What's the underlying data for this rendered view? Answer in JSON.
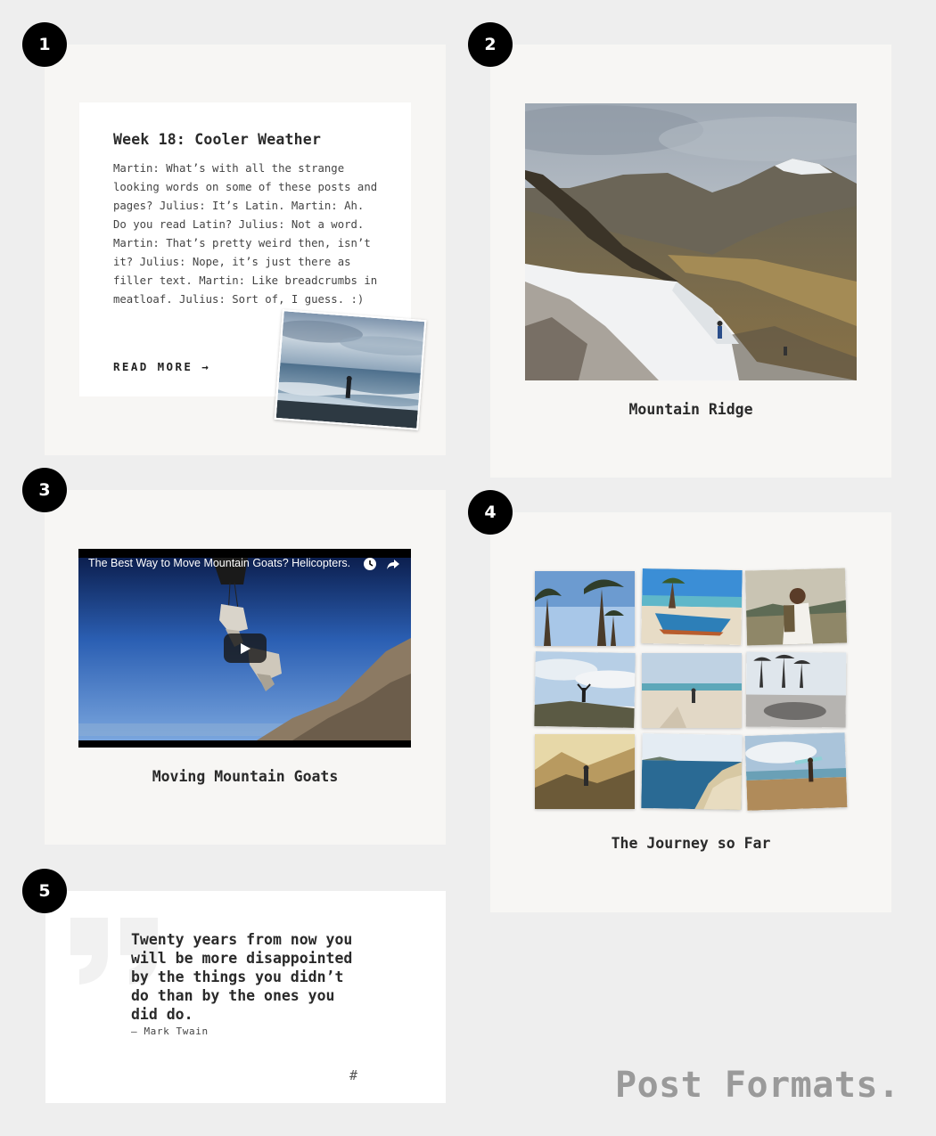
{
  "badges": [
    "1",
    "2",
    "3",
    "4",
    "5"
  ],
  "standard_post": {
    "title": "Week 18: Cooler Weather",
    "excerpt": "Martin: What’s with all the strange\nlooking words on some of these posts and\npages? Julius: It’s Latin. Martin: Ah.\nDo you read Latin? Julius: Not a word.\nMartin: That’s pretty weird then, isn’t\nit? Julius: Nope, it’s just there as\nfiller text. Martin: Like breadcrumbs in\nmeatloaf. Julius: Sort of, I guess. :)",
    "read_more": "READ MORE →"
  },
  "image_post": {
    "caption": "Mountain Ridge"
  },
  "video_post": {
    "video_title": "The Best Way to Move Mountain Goats? Helicopters.",
    "caption": "Moving Mountain Goats",
    "icons": [
      "clock-icon",
      "share-icon",
      "play-icon"
    ]
  },
  "gallery_post": {
    "caption": "The Journey so Far",
    "tiles": [
      "palm-trees",
      "beach-boat",
      "hiker-backpack",
      "mountain-cheer",
      "beach-runner",
      "skatepark",
      "valley-hiker",
      "coastline",
      "surfer"
    ]
  },
  "quote_post": {
    "quote": "Twenty years from now you\nwill be more disappointed\nby the things you didn’t\ndo than by the ones you\ndid do.",
    "author": "— Mark Twain",
    "permalink": "#"
  },
  "footer": {
    "title": "Post Formats."
  }
}
